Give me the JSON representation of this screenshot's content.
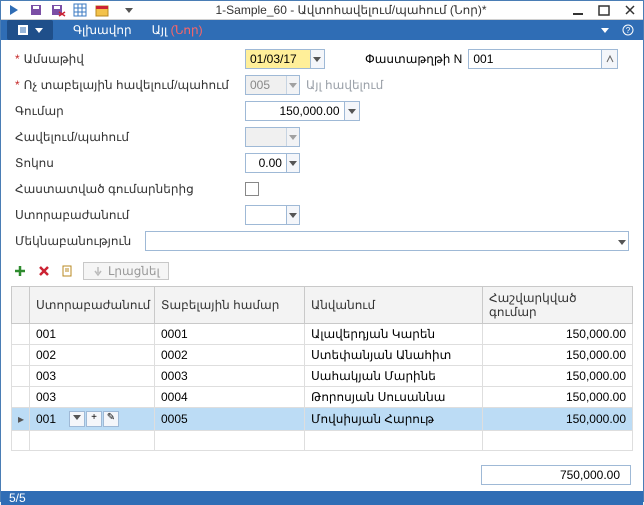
{
  "window": {
    "title": "1-Sample_60  -  Ավտոհավելում/պահում (Նոր)*"
  },
  "toolbar": {
    "tabs": {
      "main": "Գլխավոր",
      "other": "Այլ",
      "new_suffix": "(Նոր)"
    }
  },
  "form": {
    "date_label": "Ամսաթիվ",
    "date_value": "01/03/17",
    "doc_label": "Փաստաթղթի N",
    "doc_value": "001",
    "nontab_label": "Ոչ տաբելային հավելում/պահում",
    "nontab_value": "005",
    "nontab_hint": "Այլ հավելում",
    "amount_label": "Գումար",
    "amount_value": "150,000.00",
    "addhold_label": "Հավելում/պահում",
    "percent_label": "Տոկոս",
    "percent_value": "0.00",
    "approved_label": "Հաստատված գումարներից",
    "dept_label": "Ստորաբաժանում",
    "comment_label": "Մեկնաբանություն"
  },
  "actions": {
    "fill": "Լրացնել"
  },
  "grid": {
    "columns": {
      "dept": "Ստորաբաժանում",
      "tabnum": "Տաբելային համար",
      "name": "Անվանում",
      "calc": "Հաշվարկված գումար"
    },
    "rows": [
      {
        "dept": "001",
        "tab": "0001",
        "name": "Ալավերդյան Կարեն",
        "amount": "150,000.00"
      },
      {
        "dept": "002",
        "tab": "0002",
        "name": "Ստեփանյան Անահիտ",
        "amount": "150,000.00"
      },
      {
        "dept": "003",
        "tab": "0003",
        "name": "Սահակյան Մարինե",
        "amount": "150,000.00"
      },
      {
        "dept": "003",
        "tab": "0004",
        "name": "Թորոսյան Սուսաննա",
        "amount": "150,000.00"
      },
      {
        "dept": "001",
        "tab": "0005",
        "name": "Մովսիսյան Հարութ",
        "amount": "150,000.00"
      }
    ],
    "total": "750,000.00"
  },
  "status": {
    "counter": "5/5"
  }
}
